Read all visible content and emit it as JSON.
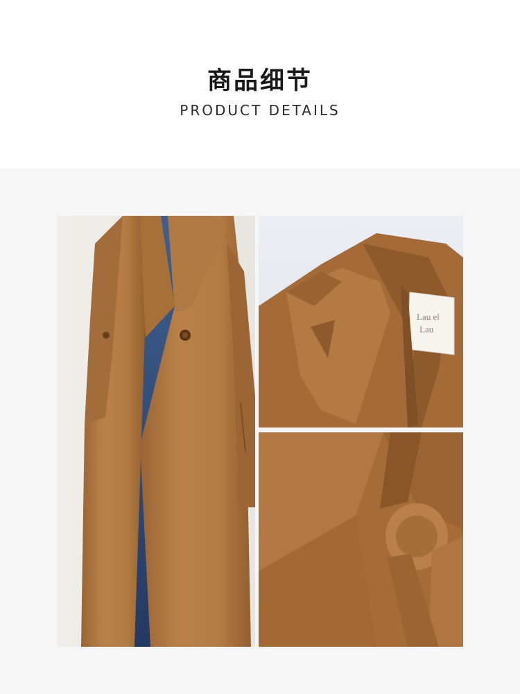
{
  "header": {
    "title_cn": "商品细节",
    "title_en": "PRODUCT DETAILS"
  },
  "gallery": {
    "background_color": "#f6f6f6",
    "images": [
      {
        "name": "coat-full-front-photo",
        "subject": "camel long wool coat worn over denim shirt and jeans"
      },
      {
        "name": "collar-label-detail-photo",
        "subject": "notched lapel and brand label close-up",
        "label_text": "Lau el Lau"
      },
      {
        "name": "belt-tie-detail-photo",
        "subject": "knotted waist belt close-up"
      }
    ]
  },
  "colors": {
    "camel": "#b27a45",
    "camel_dark": "#8c5a2f",
    "denim": "#2e4a76",
    "title": "#1a1a1a"
  }
}
